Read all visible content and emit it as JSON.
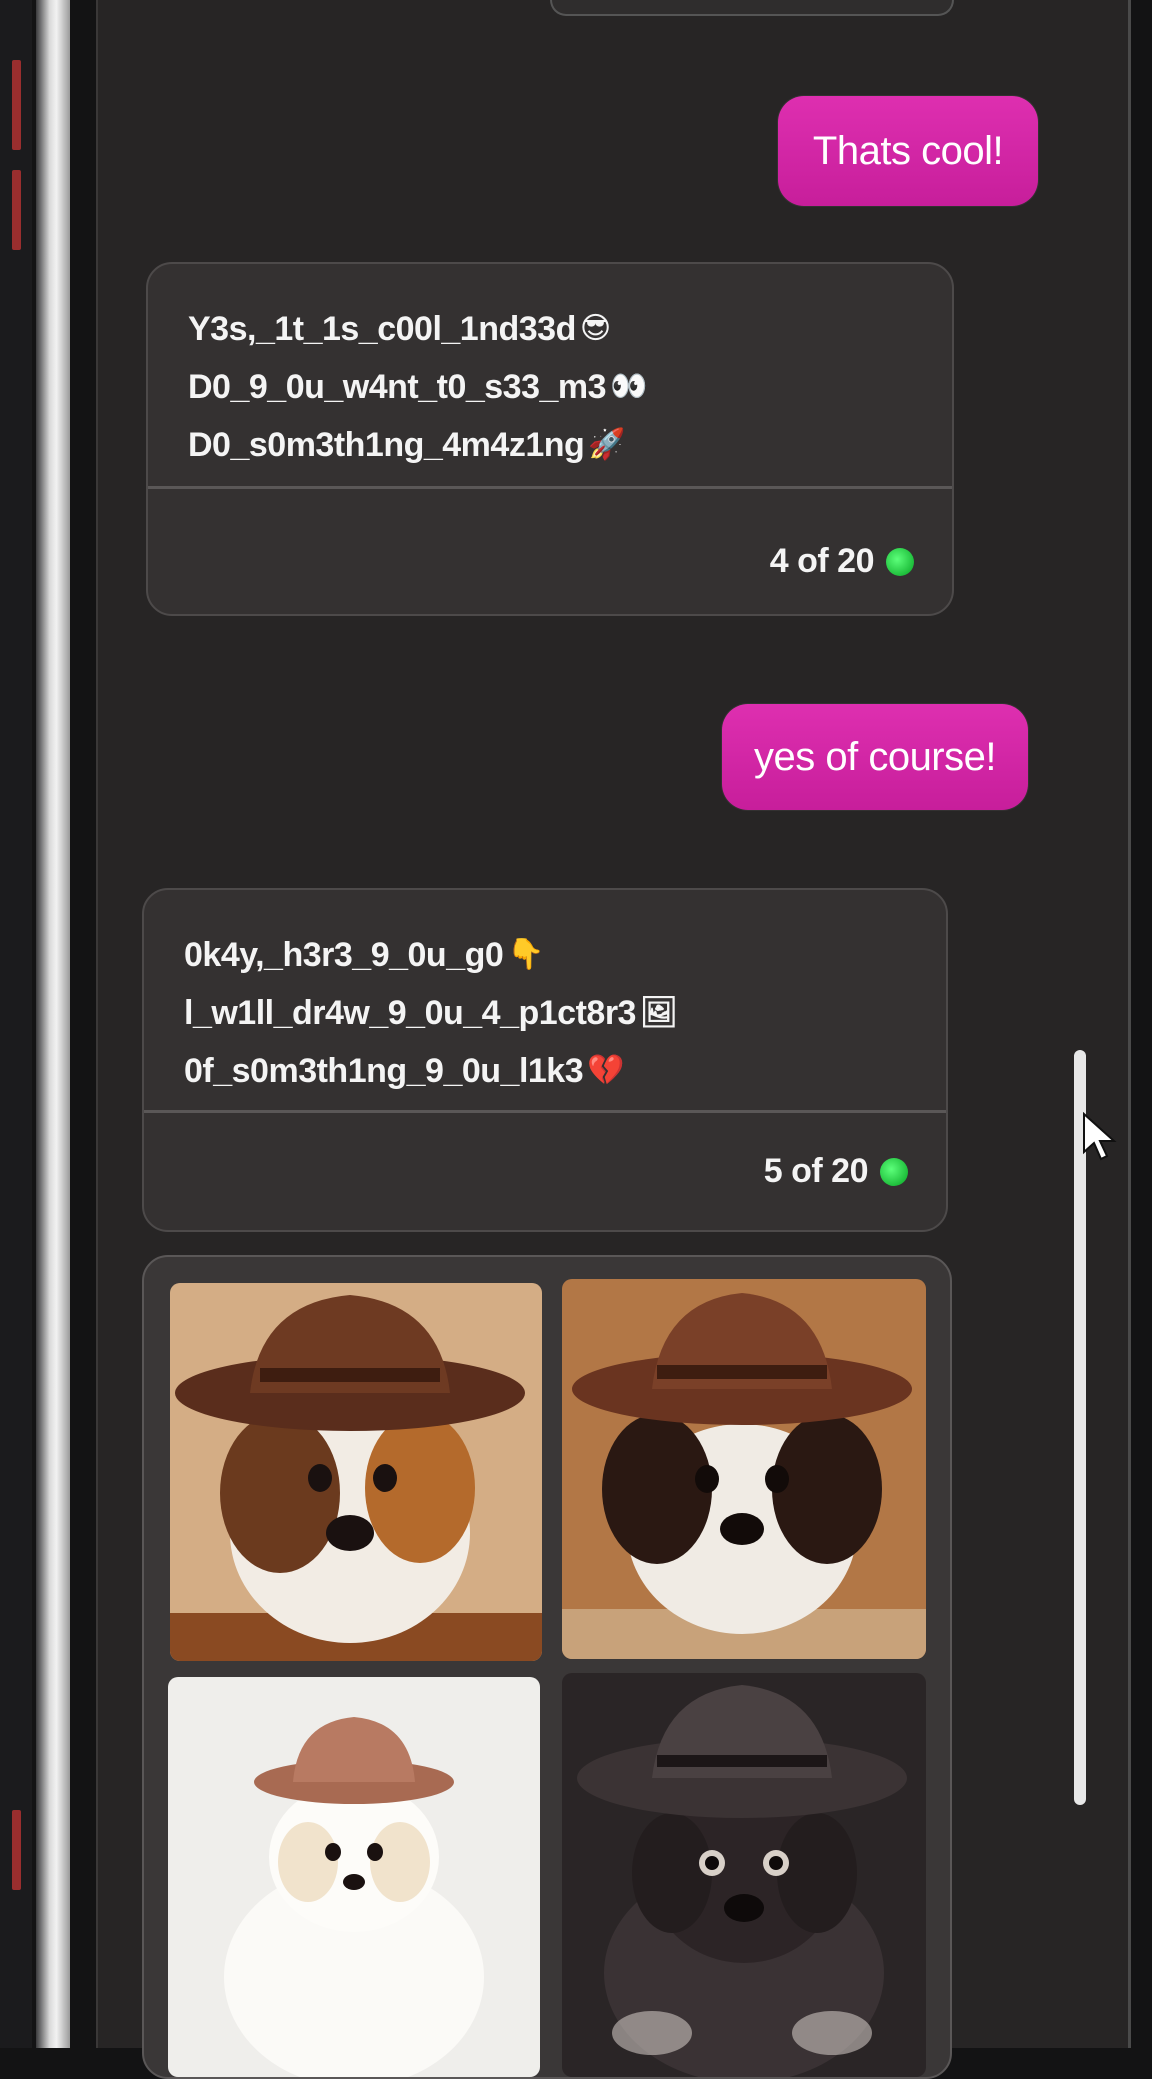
{
  "messages": [
    {
      "role": "user",
      "text": "Thats cool!"
    },
    {
      "role": "bot",
      "lines": [
        {
          "text": "Y3s,_1t_1s_c00l_1nd33d",
          "emoji": "😎"
        },
        {
          "text": "D0_9_0u_w4nt_t0_s33_m3",
          "emoji": "👀"
        },
        {
          "text": "D0_s0m3th1ng_4m4z1ng",
          "emoji": "🚀"
        }
      ],
      "counter": "4 of 20"
    },
    {
      "role": "user",
      "text": "yes of course!"
    },
    {
      "role": "bot",
      "lines": [
        {
          "text": "0k4y,_h3r3_9_0u_g0",
          "emoji": "👇"
        },
        {
          "text": "l_w1ll_dr4w_9_0u_4_p1ct8r3",
          "emoji": "🖼"
        },
        {
          "text": "0f_s0m3th1ng_9_0u_l1k3",
          "emoji": "💔"
        }
      ],
      "counter": "5 of 20"
    }
  ],
  "images": [
    {
      "subject": "puppy wearing brown cowboy hat",
      "bg": "#c99a6a"
    },
    {
      "subject": "puppy wearing brown cowboy hat",
      "bg": "#9a5a2a"
    },
    {
      "subject": "white puppy wearing brown cowboy hat",
      "bg": "#efeeeb"
    },
    {
      "subject": "black puppy wearing black cowboy hat",
      "bg": "#2a2526"
    }
  ],
  "colors": {
    "user_bubble": "#d425a6",
    "bot_bubble": "#343131",
    "status_dot": "#22c53f"
  }
}
